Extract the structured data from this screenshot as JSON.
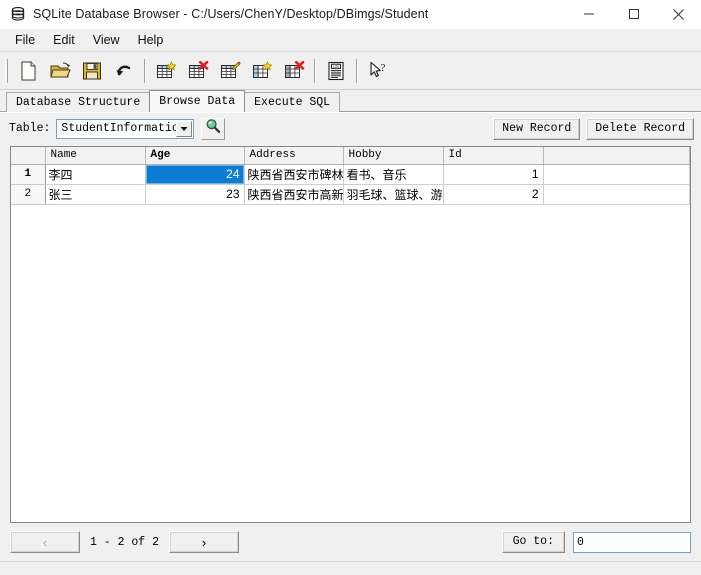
{
  "window": {
    "title": "SQLite Database Browser - C:/Users/ChenY/Desktop/DBimgs/Student",
    "app_icon": "database-icon",
    "minimize_label": "─",
    "maximize_label": "□",
    "close_label": "✕"
  },
  "menubar": {
    "items": [
      {
        "label": "File"
      },
      {
        "label": "Edit"
      },
      {
        "label": "View"
      },
      {
        "label": "Help"
      }
    ]
  },
  "toolbar": {
    "groups": [
      [
        {
          "name": "new-database-icon",
          "tooltip": "New Database"
        },
        {
          "name": "open-database-icon",
          "tooltip": "Open Database"
        },
        {
          "name": "save-icon",
          "tooltip": "Write Changes"
        },
        {
          "name": "undo-icon",
          "tooltip": "Revert Changes"
        }
      ],
      [
        {
          "name": "create-table-icon",
          "tooltip": "Create Table"
        },
        {
          "name": "delete-table-icon",
          "tooltip": "Delete Table"
        },
        {
          "name": "modify-table-icon",
          "tooltip": "Modify Table"
        },
        {
          "name": "create-index-icon",
          "tooltip": "Create Index"
        },
        {
          "name": "delete-index-icon",
          "tooltip": "Delete Index"
        }
      ],
      [
        {
          "name": "log-icon",
          "tooltip": "SQL Log"
        }
      ],
      [
        {
          "name": "help-cursor-icon",
          "tooltip": "What's This?"
        }
      ]
    ]
  },
  "tabs": [
    {
      "label": "Database Structure",
      "active": false
    },
    {
      "label": "Browse Data",
      "active": true
    },
    {
      "label": "Execute SQL",
      "active": false
    }
  ],
  "browse": {
    "table_label": "Table:",
    "table_selected": "StudentInformation",
    "search_icon": "magnifier-icon",
    "new_record_label": "New Record",
    "delete_record_label": "Delete Record"
  },
  "grid": {
    "columns": [
      "Name",
      "Age",
      "Address",
      "Hobby",
      "Id"
    ],
    "active_column": "Age",
    "rows": [
      {
        "number": "1",
        "selected": true,
        "cells": [
          "李四",
          "24",
          "陕西省西安市碑林",
          "看书、音乐",
          "1"
        ]
      },
      {
        "number": "2",
        "selected": false,
        "cells": [
          "张三",
          "23",
          "陕西省西安市高新",
          "羽毛球、篮球、游",
          "2"
        ]
      }
    ],
    "selected_cell": {
      "row": 0,
      "column": 1
    }
  },
  "footer": {
    "prev_label": "‹",
    "next_label": "›",
    "counter": "1 - 2 of 2",
    "goto_label": "Go to:",
    "goto_value": "0"
  },
  "colors": {
    "selection_blue": "#0f7cd4",
    "window_bg": "#f0f0f0",
    "grid_bg": "#ffffff"
  }
}
